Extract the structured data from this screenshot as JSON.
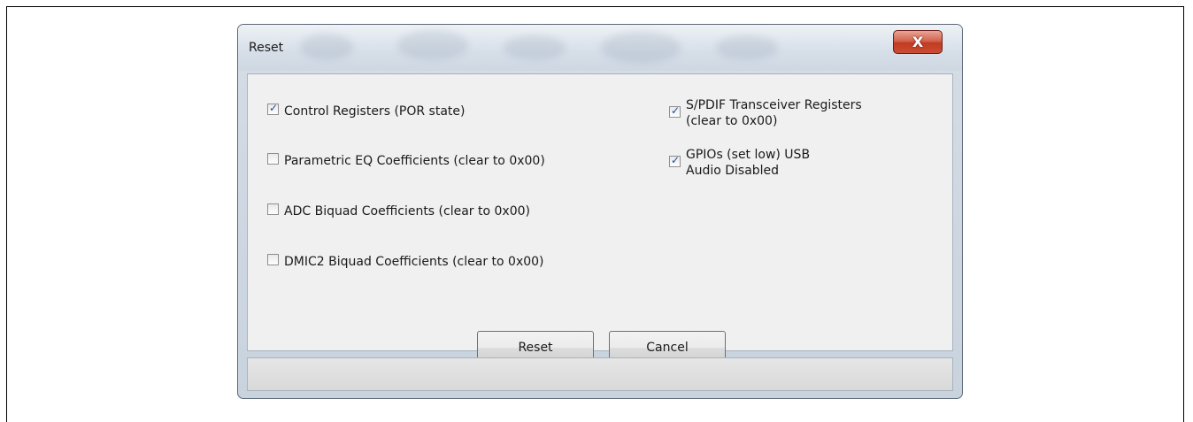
{
  "window": {
    "title": "Reset",
    "close_label": "X"
  },
  "options": {
    "left": [
      {
        "label": "Control Registers (POR state)",
        "checked": true
      },
      {
        "label": "Parametric EQ Coefficients (clear to 0x00)",
        "checked": false
      },
      {
        "label": "ADC Biquad Coefficients (clear to 0x00)",
        "checked": false
      },
      {
        "label": "DMIC2 Biquad Coefficients (clear to 0x00)",
        "checked": false
      }
    ],
    "right": [
      {
        "line1": "S/PDIF Transceiver Registers",
        "line2": "(clear to 0x00)",
        "checked": true
      },
      {
        "line1": "GPIOs (set low) USB",
        "line2": "Audio Disabled",
        "checked": true
      }
    ]
  },
  "buttons": {
    "reset_label": "Reset",
    "cancel_label": "Cancel"
  },
  "colors": {
    "checkmark": "#1d4b9b",
    "close_button": "#c23b22"
  }
}
